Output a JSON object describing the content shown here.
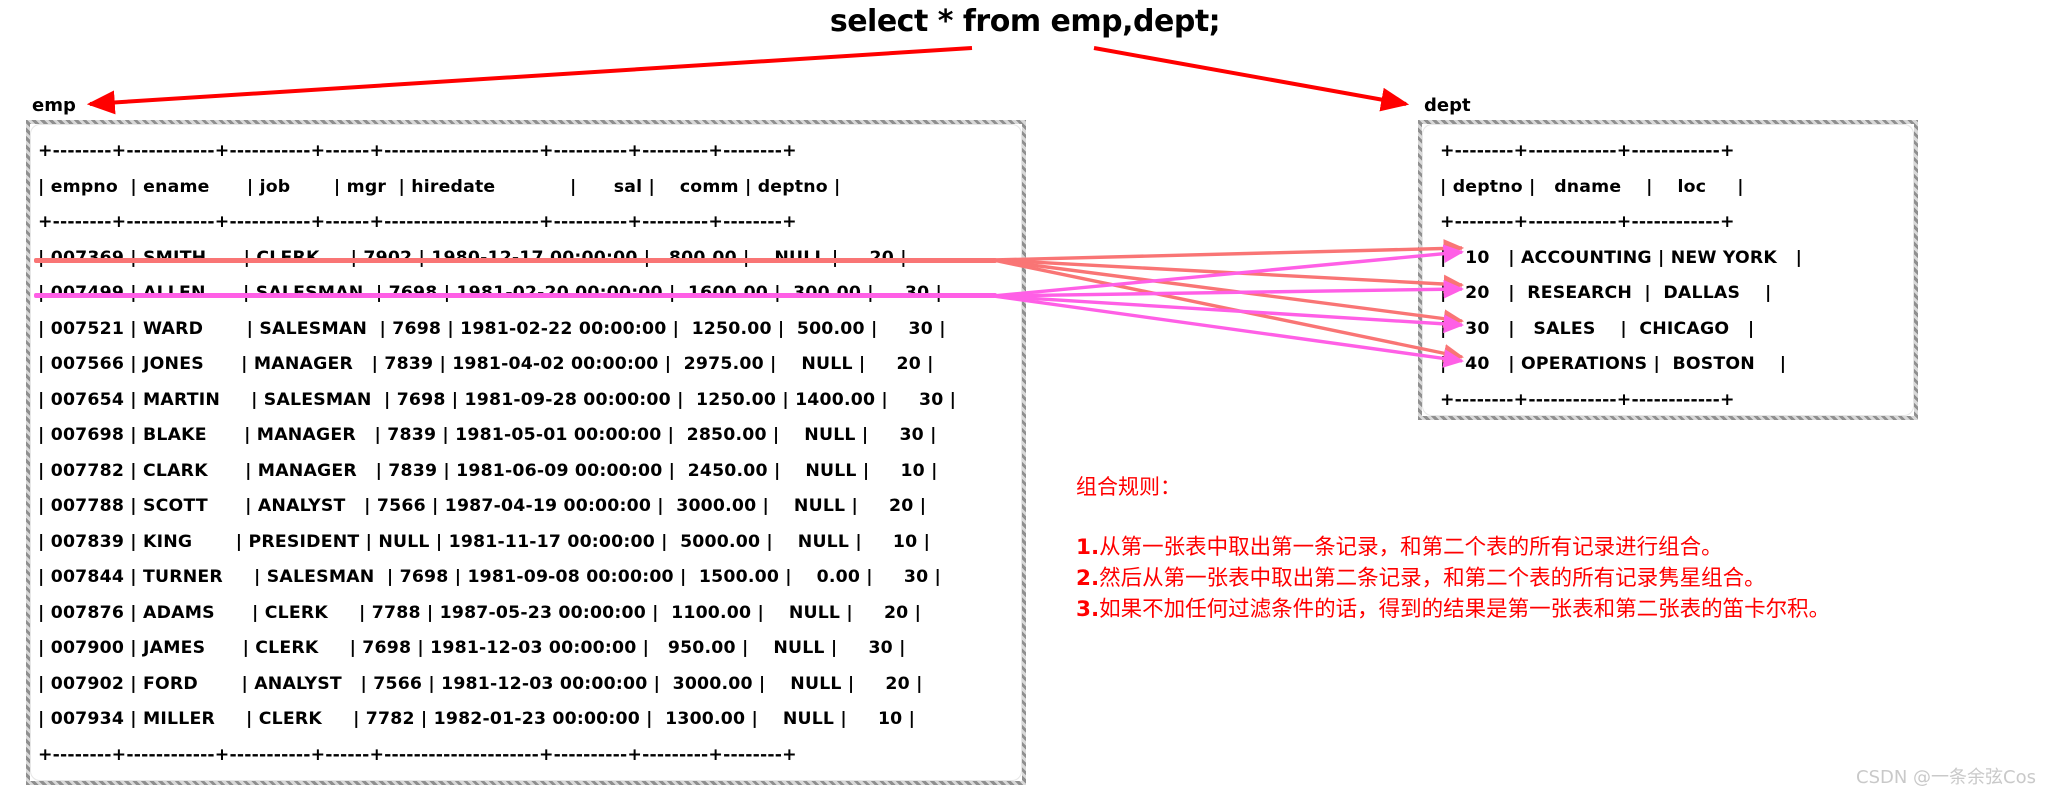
{
  "title": {
    "sql": "select * from emp,dept;"
  },
  "labels": {
    "emp": "emp",
    "dept": "dept"
  },
  "colors": {
    "title_arrow": "#ff0000",
    "row1_highlight": "#f97575",
    "row2_highlight": "#ff5fe6",
    "annotation_text": "#ff0000",
    "watermark": "#c9c9c9",
    "card_border": "#8f8f8f"
  },
  "emp_table": {
    "separator": "+--------+------------+-----------+------+---------------------+----------+---------+--------+",
    "columns": [
      "empno",
      "ename",
      "job",
      "mgr",
      "hiredate",
      "sal",
      "comm",
      "deptno"
    ],
    "header_line": "| empno  | ename      | job       | mgr  | hiredate            | sal      | comm    | deptno |",
    "rows": [
      {
        "empno": "007369",
        "ename": "SMITH",
        "job": "CLERK",
        "mgr": "7902",
        "hiredate": "1980-12-17 00:00:00",
        "sal": "800.00",
        "comm": "NULL",
        "deptno": "20"
      },
      {
        "empno": "007499",
        "ename": "ALLEN",
        "job": "SALESMAN",
        "mgr": "7698",
        "hiredate": "1981-02-20 00:00:00",
        "sal": "1600.00",
        "comm": "300.00",
        "deptno": "30"
      },
      {
        "empno": "007521",
        "ename": "WARD",
        "job": "SALESMAN",
        "mgr": "7698",
        "hiredate": "1981-02-22 00:00:00",
        "sal": "1250.00",
        "comm": "500.00",
        "deptno": "30"
      },
      {
        "empno": "007566",
        "ename": "JONES",
        "job": "MANAGER",
        "mgr": "7839",
        "hiredate": "1981-04-02 00:00:00",
        "sal": "2975.00",
        "comm": "NULL",
        "deptno": "20"
      },
      {
        "empno": "007654",
        "ename": "MARTIN",
        "job": "SALESMAN",
        "mgr": "7698",
        "hiredate": "1981-09-28 00:00:00",
        "sal": "1250.00",
        "comm": "1400.00",
        "deptno": "30"
      },
      {
        "empno": "007698",
        "ename": "BLAKE",
        "job": "MANAGER",
        "mgr": "7839",
        "hiredate": "1981-05-01 00:00:00",
        "sal": "2850.00",
        "comm": "NULL",
        "deptno": "30"
      },
      {
        "empno": "007782",
        "ename": "CLARK",
        "job": "MANAGER",
        "mgr": "7839",
        "hiredate": "1981-06-09 00:00:00",
        "sal": "2450.00",
        "comm": "NULL",
        "deptno": "10"
      },
      {
        "empno": "007788",
        "ename": "SCOTT",
        "job": "ANALYST",
        "mgr": "7566",
        "hiredate": "1987-04-19 00:00:00",
        "sal": "3000.00",
        "comm": "NULL",
        "deptno": "20"
      },
      {
        "empno": "007839",
        "ename": "KING",
        "job": "PRESIDENT",
        "mgr": "NULL",
        "hiredate": "1981-11-17 00:00:00",
        "sal": "5000.00",
        "comm": "NULL",
        "deptno": "10"
      },
      {
        "empno": "007844",
        "ename": "TURNER",
        "job": "SALESMAN",
        "mgr": "7698",
        "hiredate": "1981-09-08 00:00:00",
        "sal": "1500.00",
        "comm": "0.00",
        "deptno": "30"
      },
      {
        "empno": "007876",
        "ename": "ADAMS",
        "job": "CLERK",
        "mgr": "7788",
        "hiredate": "1987-05-23 00:00:00",
        "sal": "1100.00",
        "comm": "NULL",
        "deptno": "20"
      },
      {
        "empno": "007900",
        "ename": "JAMES",
        "job": "CLERK",
        "mgr": "7698",
        "hiredate": "1981-12-03 00:00:00",
        "sal": "950.00",
        "comm": "NULL",
        "deptno": "30"
      },
      {
        "empno": "007902",
        "ename": "FORD",
        "job": "ANALYST",
        "mgr": "7566",
        "hiredate": "1981-12-03 00:00:00",
        "sal": "3000.00",
        "comm": "NULL",
        "deptno": "20"
      },
      {
        "empno": "007934",
        "ename": "MILLER",
        "job": "CLERK",
        "mgr": "7782",
        "hiredate": "1982-01-23 00:00:00",
        "sal": "1300.00",
        "comm": "NULL",
        "deptno": "10"
      }
    ],
    "text": "+--------+------------+-----------+------+---------------------+----------+---------+--------+\n| empno  | ename      | job       | mgr  | hiredate            |      sal |    comm | deptno |\n+--------+------------+-----------+------+---------------------+----------+---------+--------+\n| 007369 | SMITH      | CLERK     | 7902 | 1980-12-17 00:00:00 |   800.00 |    NULL |     20 |\n| 007499 | ALLEN      | SALESMAN  | 7698 | 1981-02-20 00:00:00 |  1600.00 |  300.00 |     30 |\n| 007521 | WARD       | SALESMAN  | 7698 | 1981-02-22 00:00:00 |  1250.00 |  500.00 |     30 |\n| 007566 | JONES      | MANAGER   | 7839 | 1981-04-02 00:00:00 |  2975.00 |    NULL |     20 |\n| 007654 | MARTIN     | SALESMAN  | 7698 | 1981-09-28 00:00:00 |  1250.00 | 1400.00 |     30 |\n| 007698 | BLAKE      | MANAGER   | 7839 | 1981-05-01 00:00:00 |  2850.00 |    NULL |     30 |\n| 007782 | CLARK      | MANAGER   | 7839 | 1981-06-09 00:00:00 |  2450.00 |    NULL |     10 |\n| 007788 | SCOTT      | ANALYST   | 7566 | 1987-04-19 00:00:00 |  3000.00 |    NULL |     20 |\n| 007839 | KING       | PRESIDENT | NULL | 1981-11-17 00:00:00 |  5000.00 |    NULL |     10 |\n| 007844 | TURNER     | SALESMAN  | 7698 | 1981-09-08 00:00:00 |  1500.00 |    0.00 |     30 |\n| 007876 | ADAMS      | CLERK     | 7788 | 1987-05-23 00:00:00 |  1100.00 |    NULL |     20 |\n| 007900 | JAMES      | CLERK     | 7698 | 1981-12-03 00:00:00 |   950.00 |    NULL |     30 |\n| 007902 | FORD       | ANALYST   | 7566 | 1981-12-03 00:00:00 |  3000.00 |    NULL |     20 |\n| 007934 | MILLER     | CLERK     | 7782 | 1982-01-23 00:00:00 |  1300.00 |    NULL |     10 |\n+--------+------------+-----------+------+---------------------+----------+---------+--------+"
  },
  "dept_table": {
    "separator": "+--------+------------+------------+",
    "columns": [
      "deptno",
      "dname",
      "loc"
    ],
    "rows": [
      {
        "deptno": "10",
        "dname": "ACCOUNTING",
        "loc": "NEW YORK"
      },
      {
        "deptno": "20",
        "dname": "RESEARCH",
        "loc": "DALLAS"
      },
      {
        "deptno": "30",
        "dname": "SALES",
        "loc": "CHICAGO"
      },
      {
        "deptno": "40",
        "dname": "OPERATIONS",
        "loc": "BOSTON"
      }
    ],
    "text": "+--------+------------+------------+\n| deptno |   dname    |    loc     |\n+--------+------------+------------+\n|   10   | ACCOUNTING | NEW YORK   |\n|   20   |  RESEARCH  |  DALLAS    |\n|   30   |   SALES    |  CHICAGO   |\n|   40   | OPERATIONS |  BOSTON    |\n+--------+------------+------------+"
  },
  "annotation": {
    "heading": "组合规则：",
    "rules": [
      {
        "num": "1.",
        "text": "从第一张表中取出第一条记录，和第二个表的所有记录进行组合。"
      },
      {
        "num": "2.",
        "text": "然后从第一张表中取出第二条记录，和第二个表的所有记录隽星组合。"
      },
      {
        "num": "3.",
        "text": "如果不加任何过滤条件的话，得到的结果是第一张表和第二张表的笛卡尔积。"
      }
    ]
  },
  "watermark": {
    "text": "CSDN @一条余弦Cos"
  }
}
